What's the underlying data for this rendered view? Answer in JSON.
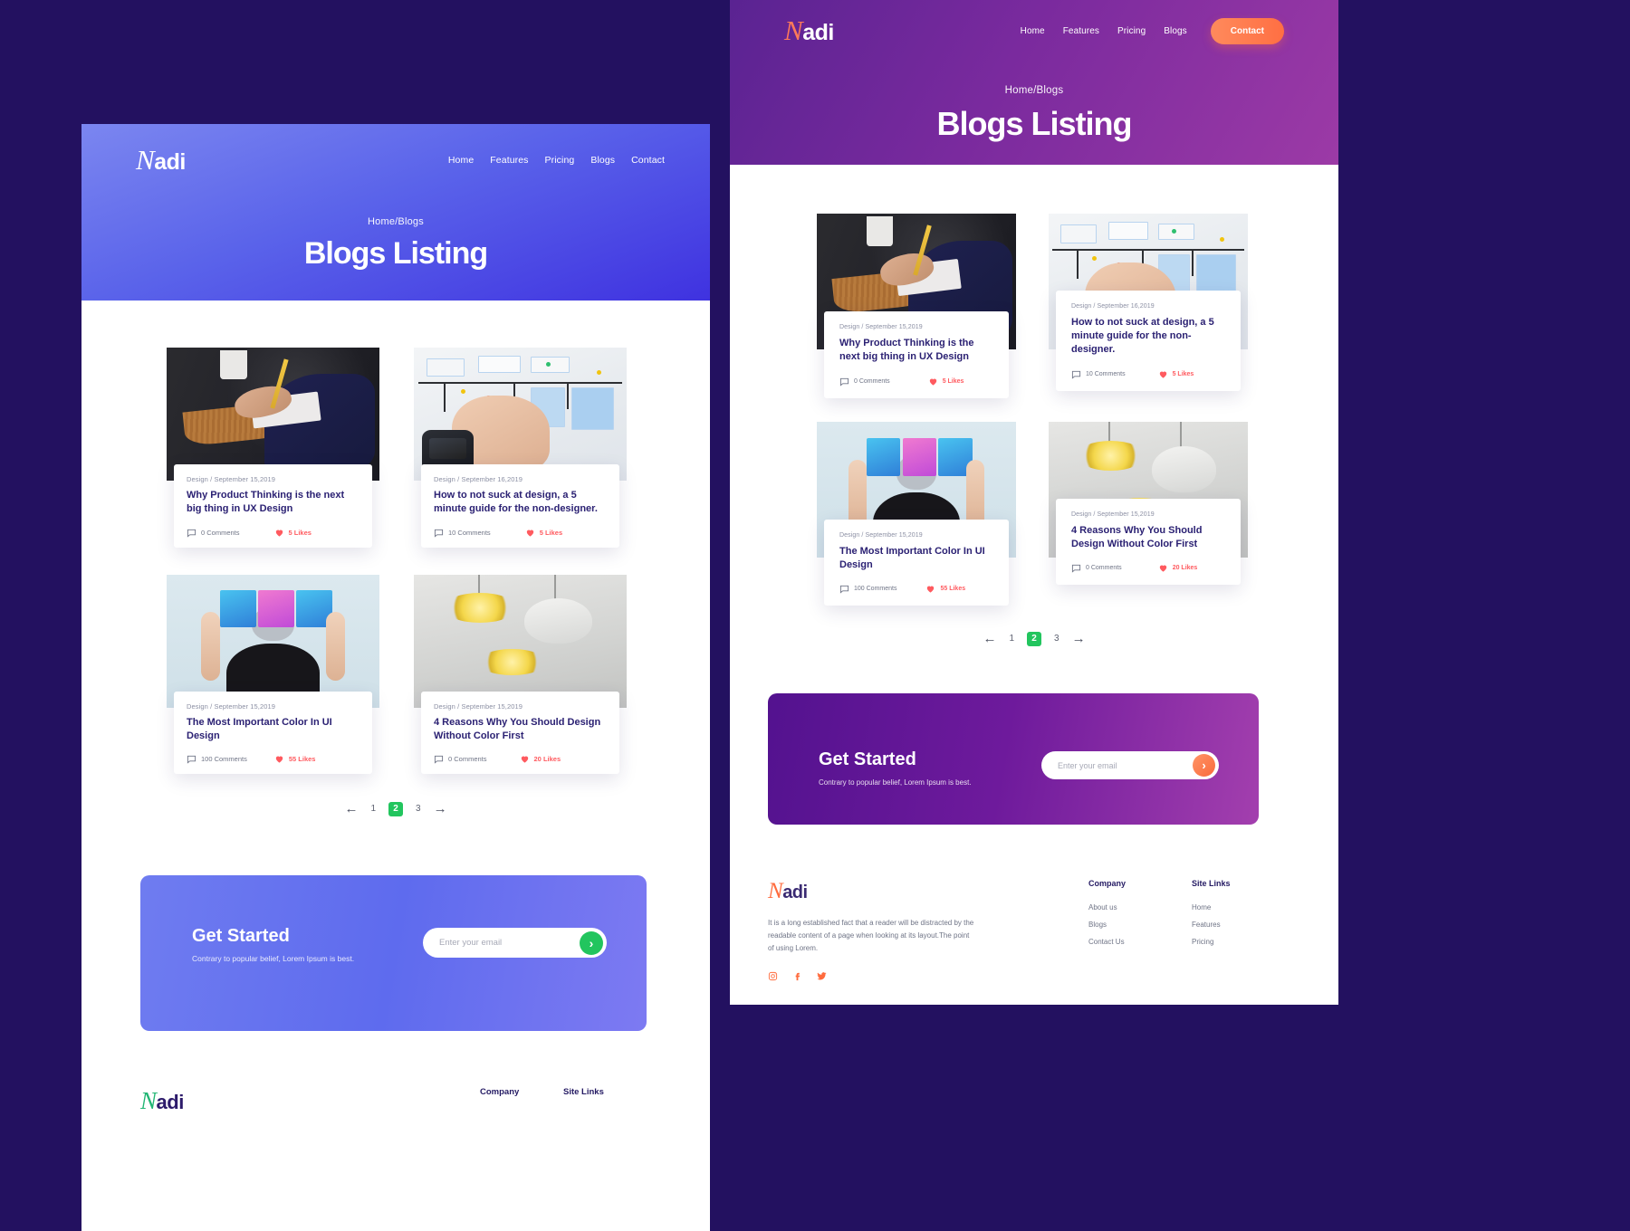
{
  "brand": {
    "name": "Nadi",
    "first_letter": "N",
    "rest": "adi"
  },
  "nav": {
    "items": [
      "Home",
      "Features",
      "Pricing",
      "Blogs",
      "Contact"
    ],
    "items_right": [
      "Home",
      "Features",
      "Pricing",
      "Blogs"
    ],
    "cta_label": "Contact"
  },
  "hero": {
    "breadcrumb": "Home/Blogs",
    "title": "Blogs Listing"
  },
  "posts": [
    {
      "meta": "Design / September 15,2019",
      "title": "Why Product Thinking is the next big thing in UX Design",
      "comments": "0 Comments",
      "likes": "5 Likes",
      "image": "man-writing-at-desk"
    },
    {
      "meta": "Design / September 16,2019",
      "title": "How to not suck at design, a 5 minute guide for the non-designer.",
      "comments": "10 Comments",
      "likes": "5 Likes",
      "image": "hand-on-whiteboard"
    },
    {
      "meta": "Design / September 15,2019",
      "title": "The Most Important Color In UI Design",
      "comments": "100 Comments",
      "likes": "55 Likes",
      "image": "person-holding-screens"
    },
    {
      "meta": "Design / September 15,2019",
      "title": "4 Reasons Why You Should Design Without Color First",
      "comments": "0 Comments",
      "likes": "20 Likes",
      "image": "pendant-lamps"
    }
  ],
  "pagination": {
    "prev": "←",
    "next": "→",
    "pages": [
      "1",
      "2",
      "3"
    ],
    "active": "2"
  },
  "get_started": {
    "title": "Get Started",
    "subtitle": "Contrary to popular belief, Lorem Ipsum is best.",
    "email_placeholder": "Enter your email",
    "submit_glyph": "›"
  },
  "footer": {
    "about": "It is a long established fact that a reader will be distracted by the readable content of a page when looking at its layout.The point of using Lorem.",
    "col1": {
      "heading": "Company",
      "links": [
        "About us",
        "Blogs",
        "Contact Us"
      ]
    },
    "col2": {
      "heading": "Site Links",
      "links": [
        "Home",
        "Features",
        "Pricing"
      ]
    },
    "socials": [
      "instagram-icon",
      "facebook-icon",
      "twitter-icon"
    ]
  },
  "colors": {
    "canvas": "#231160",
    "left_hero_from": "#7b86f0",
    "left_hero_to": "#3f32e0",
    "right_hero_from": "#5a2392",
    "right_hero_to": "#9c3aa6",
    "accent_green": "#22c55e",
    "accent_orange": "#ff6f43",
    "likes_red": "#ff5a5f",
    "title_navy": "#2b2173"
  }
}
